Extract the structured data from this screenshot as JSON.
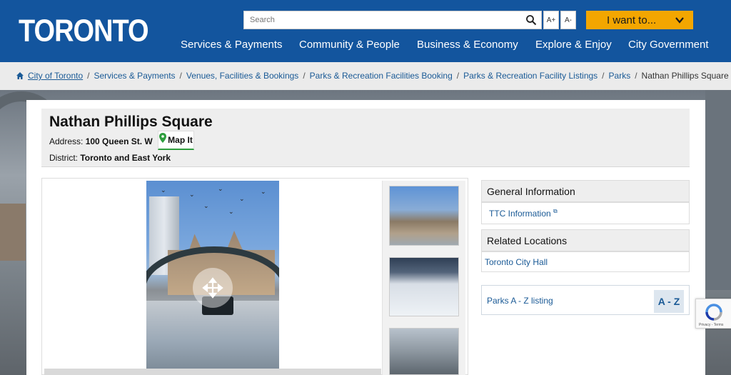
{
  "header": {
    "logo_text": "TORONTO",
    "search_placeholder": "Search",
    "font_increase": "A+",
    "font_decrease": "A-",
    "i_want_to": "I want to...",
    "nav": [
      "Services & Payments",
      "Community & People",
      "Business & Economy",
      "Explore & Enjoy",
      "City Government"
    ]
  },
  "breadcrumb": [
    "City of Toronto",
    "Services & Payments",
    "Venues, Facilities & Bookings",
    "Parks & Recreation Facilities Booking",
    "Parks & Recreation Facility Listings",
    "Parks",
    "Nathan Phillips Square"
  ],
  "location": {
    "title": "Nathan Phillips Square",
    "address_label": "Address:",
    "address": "100 Queen St. W",
    "map_it": "Map It",
    "district_label": "District:",
    "district": "Toronto and East York"
  },
  "sidebar": {
    "general_info_heading": "General Information",
    "ttc_link": "TTC Information",
    "related_heading": "Related Locations",
    "related_link": "Toronto City Hall",
    "az_link": "Parks A - Z listing",
    "az_badge": "A - Z"
  },
  "recaptcha": {
    "footer": "Privacy - Terms"
  },
  "colors": {
    "header_bg": "#13559e",
    "accent_button": "#f3a600",
    "link": "#1a5a96",
    "map_pin": "#2e9e3e"
  }
}
